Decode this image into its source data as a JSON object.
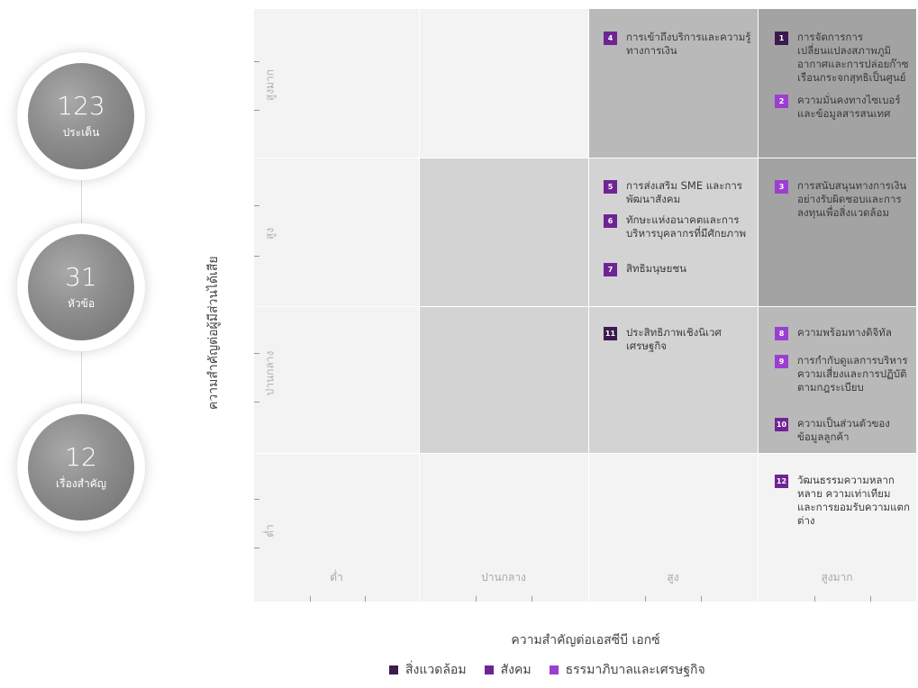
{
  "funnel": [
    {
      "number": "123",
      "label": "ประเด็น"
    },
    {
      "number": "31",
      "label": "หัวข้อ"
    },
    {
      "number": "12",
      "label": "เรื่องสำคัญ"
    }
  ],
  "axes": {
    "y_title": "ความสำคัญต่อผู้มีส่วนได้เสีย",
    "x_title": "ความสำคัญต่อเอสซีบี เอกซ์",
    "y_levels": [
      "สูงมาก",
      "สูง",
      "ปานกลาง",
      "ต่ำ"
    ],
    "x_levels": [
      "ต่ำ",
      "ปานกลาง",
      "สูง",
      "สูงมาก"
    ]
  },
  "colors": {
    "environment": "#3b1a4f",
    "social": "#6f2494",
    "governance": "#9b3fd0"
  },
  "items": [
    {
      "n": "1",
      "cat": "env",
      "text": "การจัดการการเปลี่ยนแปลงสภาพภูมิอากาศและการปล่อยก๊าซเรือนกระจกสุทธิเป็นศูนย์"
    },
    {
      "n": "2",
      "cat": "gov",
      "text": "ความมั่นคงทางไซเบอร์และข้อมูลสารสนเทศ"
    },
    {
      "n": "3",
      "cat": "gov",
      "text": "การสนับสนุนทางการเงินอย่างรับผิดชอบและการลงทุนเพื่อสิ่งแวดล้อม"
    },
    {
      "n": "4",
      "cat": "soc",
      "text": "การเข้าถึงบริการและความรู้ทางการเงิน"
    },
    {
      "n": "5",
      "cat": "soc",
      "text": "การส่งเสริม SME และการพัฒนาสังคม"
    },
    {
      "n": "6",
      "cat": "soc",
      "text": "ทักษะแห่งอนาคตและการบริหารบุคลากรที่มีศักยภาพ"
    },
    {
      "n": "7",
      "cat": "soc",
      "text": "สิทธิมนุษยชน"
    },
    {
      "n": "8",
      "cat": "gov",
      "text": "ความพร้อมทางดิจิทัล"
    },
    {
      "n": "9",
      "cat": "gov",
      "text": "การกำกับดูแลการบริหารความเสี่ยงและการปฏิบัติตามกฎระเบียบ"
    },
    {
      "n": "10",
      "cat": "soc",
      "text": "ความเป็นส่วนตัวของข้อมูลลูกค้า"
    },
    {
      "n": "11",
      "cat": "env",
      "text": "ประสิทธิภาพเชิงนิเวศเศรษฐกิจ"
    },
    {
      "n": "12",
      "cat": "soc",
      "text": "วัฒนธรรมความหลากหลาย ความเท่าเทียม และการยอมรับความแตกต่าง"
    }
  ],
  "legend": [
    {
      "label": "สิ่งแวดล้อม",
      "color": "#3b1a4f"
    },
    {
      "label": "สังคม",
      "color": "#6f2494"
    },
    {
      "label": "ธรรมาภิบาลและเศรษฐกิจ",
      "color": "#9b3fd0"
    }
  ]
}
